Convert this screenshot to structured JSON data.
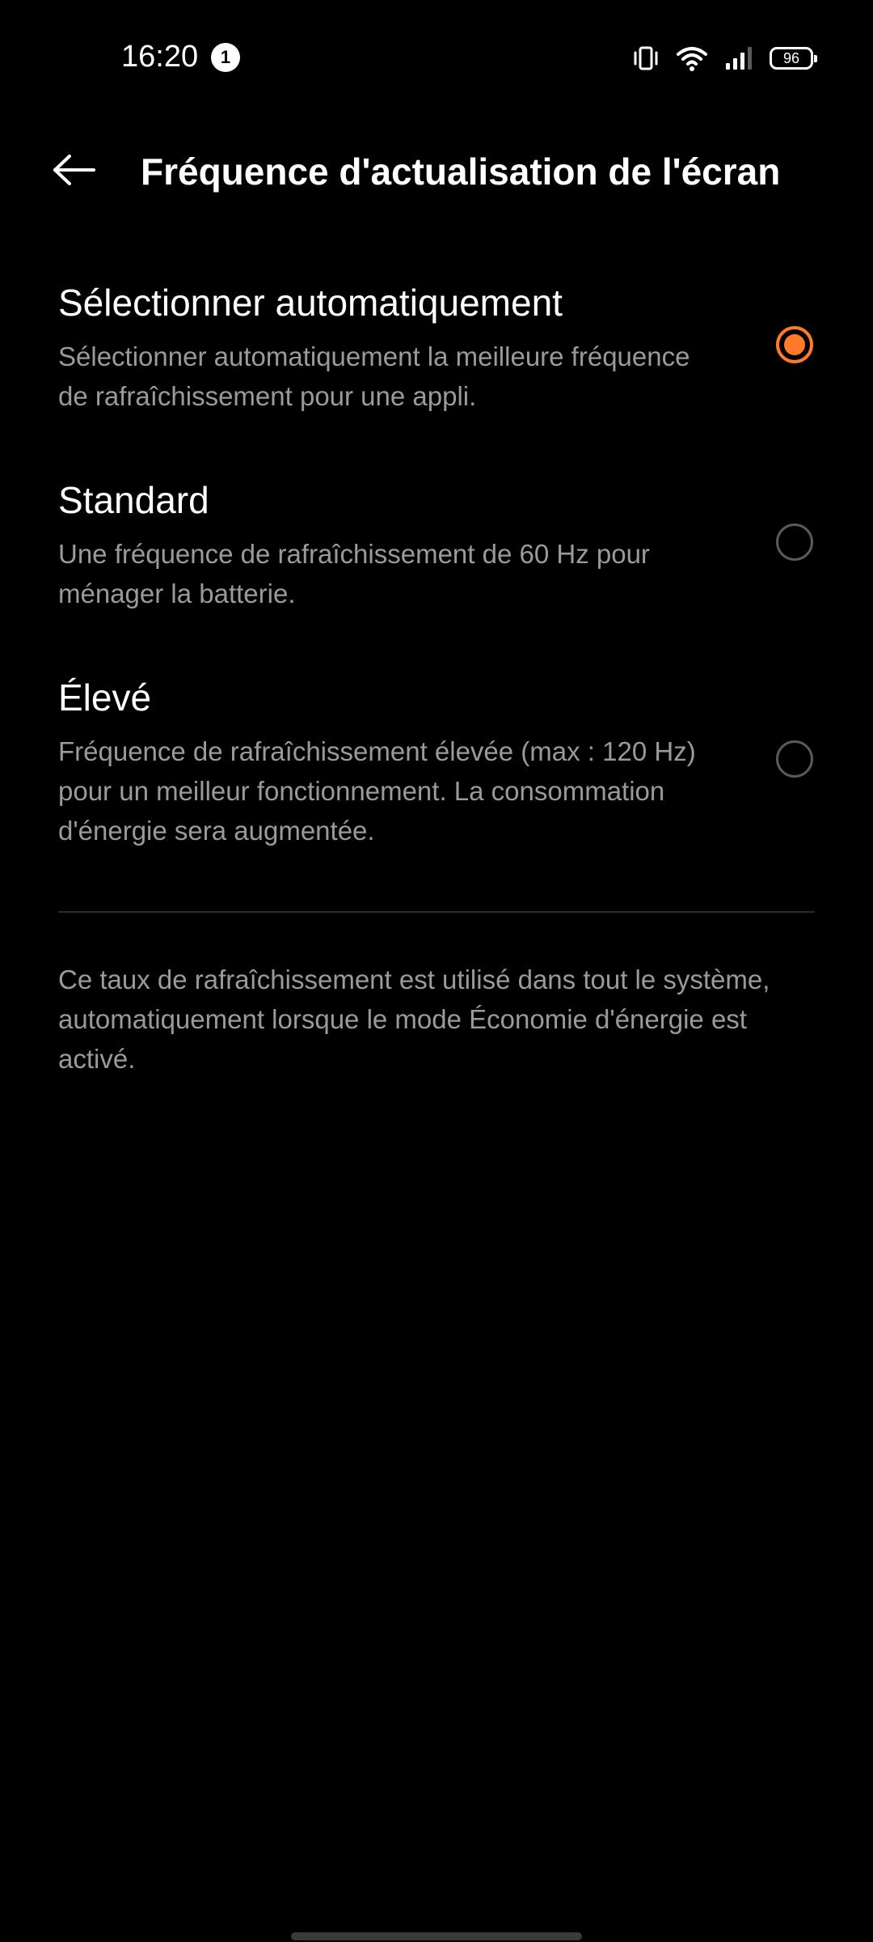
{
  "status_bar": {
    "time": "16:20",
    "notification_count": "1",
    "battery_level": "96",
    "icons": [
      "vibrate-icon",
      "wifi-icon",
      "signal-icon",
      "battery-icon"
    ]
  },
  "header": {
    "title": "Fréquence d'actualisation de l'écran",
    "back_icon": "arrow-left-icon"
  },
  "options": [
    {
      "title": "Sélectionner automatiquement",
      "description": "Sélectionner automatiquement la meilleure fréquence de rafraîchissement pour une appli.",
      "selected": true
    },
    {
      "title": "Standard",
      "description": "Une fréquence de rafraîchissement de 60 Hz pour ménager la batterie.",
      "selected": false
    },
    {
      "title": "Élevé",
      "description": "Fréquence de rafraîchissement élevée (max : 120 Hz) pour un meilleur fonctionnement. La consommation d'énergie sera augmentée.",
      "selected": false
    }
  ],
  "footer": {
    "note": "Ce taux de rafraîchissement est utilisé dans tout le système, automatiquement lorsque le mode Économie d'énergie est activé."
  },
  "colors": {
    "background": "#000000",
    "accent": "#ff7a2a",
    "secondary_text": "#9a9a9a",
    "primary_text": "#ffffff"
  }
}
